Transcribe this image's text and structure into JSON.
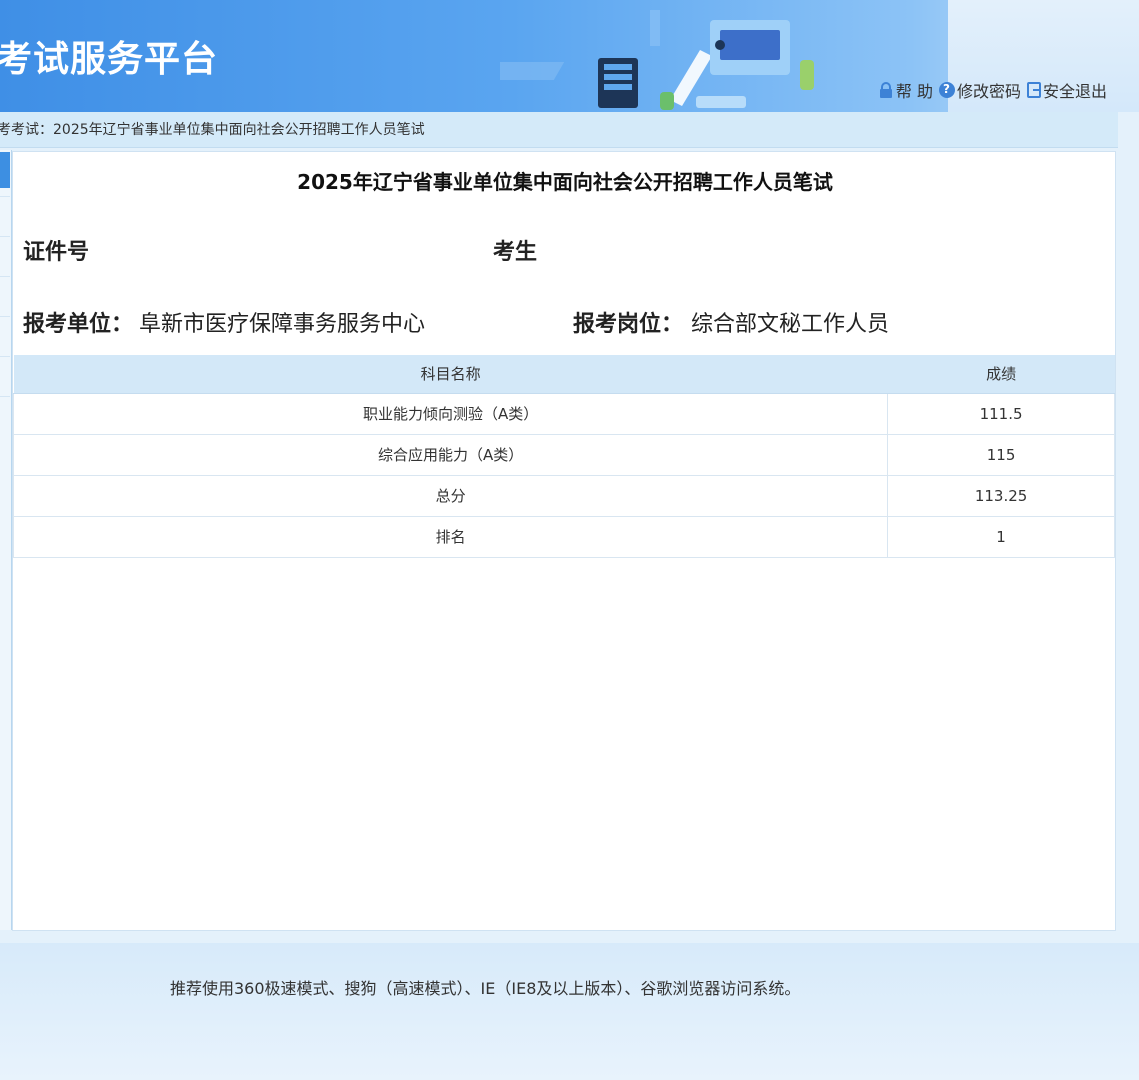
{
  "header": {
    "site_title": "考试服务平台",
    "links": [
      {
        "icon": "lock-icon",
        "label": "帮 助"
      },
      {
        "icon": "help-icon",
        "label": "修改密码"
      },
      {
        "icon": "exit-icon",
        "label": "安全退出"
      }
    ]
  },
  "breadcrumb": "考考试：2025年辽宁省事业单位集中面向社会公开招聘工作人员笔试",
  "exam": {
    "title": "2025年辽宁省事业单位集中面向社会公开招聘工作人员笔试",
    "id_label": "证件号",
    "name_label": "考生",
    "unit_label": "报考单位：",
    "unit_value": "阜新市医疗保障事务服务中心",
    "post_label": "报考岗位：",
    "post_value": "综合部文秘工作人员"
  },
  "scores": {
    "headers": [
      "科目名称",
      "成绩"
    ],
    "rows": [
      [
        "职业能力倾向测验（A类）",
        "111.5"
      ],
      [
        "综合应用能力（A类）",
        "115"
      ],
      [
        "总分",
        "113.25"
      ],
      [
        "排名",
        "1"
      ]
    ]
  },
  "footer": {
    "notice": "推荐使用360极速模式、搜狗（高速模式）、IE（IE8及以上版本）、谷歌浏览器访问系统。"
  },
  "colors": {
    "header_blue": "#4a97ea",
    "table_header": "#d3e8f8",
    "accent": "#3d82d6"
  }
}
